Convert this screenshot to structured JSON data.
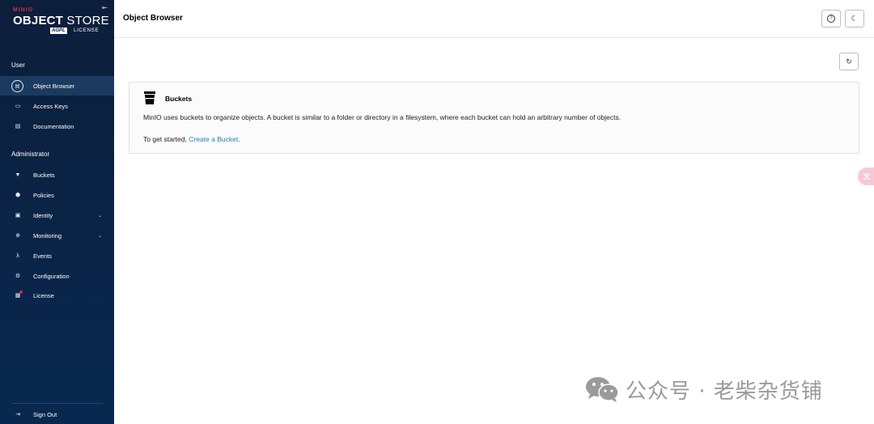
{
  "sidebar": {
    "logo": {
      "brand": "MINIO",
      "main_bold": "OBJECT",
      "main_light": " STORE",
      "edition": "AGPL",
      "license": "LICENSE"
    },
    "sections": {
      "user": "User",
      "admin": "Administrator"
    },
    "user_items": [
      {
        "label": "Object Browser",
        "icon": "object-browser-icon"
      },
      {
        "label": "Access Keys",
        "icon": "access-keys-icon"
      },
      {
        "label": "Documentation",
        "icon": "documentation-icon"
      }
    ],
    "admin_items": [
      {
        "label": "Buckets",
        "icon": "buckets-icon"
      },
      {
        "label": "Policies",
        "icon": "policies-icon"
      },
      {
        "label": "Identity",
        "icon": "identity-icon"
      },
      {
        "label": "Monitoring",
        "icon": "monitoring-icon"
      },
      {
        "label": "Events",
        "icon": "lambda-icon"
      },
      {
        "label": "Configuration",
        "icon": "gear-icon"
      },
      {
        "label": "License",
        "icon": "license-icon"
      }
    ],
    "sign_out": "Sign Out"
  },
  "header": {
    "title": "Object Browser"
  },
  "main": {
    "box_title": "Buckets",
    "description": "MinIO uses buckets to organize objects. A bucket is similar to a folder or directory in a filesystem, where each bucket can hold an arbitrary number of objects.",
    "started_prefix": "To get started, ",
    "create_link": "Create a Bucket."
  },
  "watermark": {
    "text": "公众号 · 老柴杂货铺"
  },
  "colors": {
    "sidebar_bg": "#0c1e3a",
    "active_item": "#1b3a60",
    "link": "#2781b0",
    "brand_red": "#c72c48"
  }
}
